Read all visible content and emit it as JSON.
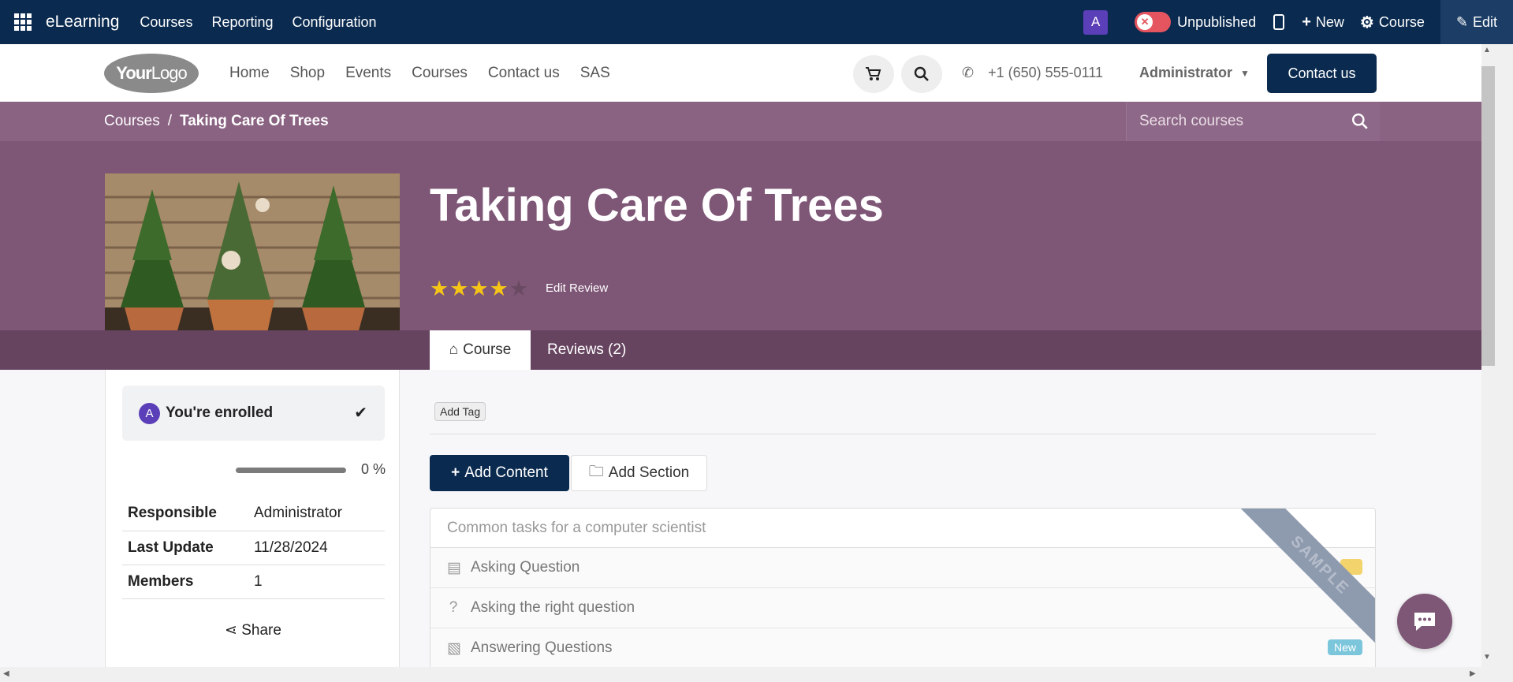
{
  "admin_bar": {
    "brand": "eLearning",
    "menu": [
      "Courses",
      "Reporting",
      "Configuration"
    ],
    "avatar_letter": "A",
    "publish_status": "Unpublished",
    "new_label": "New",
    "course_label": "Course",
    "edit_label": "Edit"
  },
  "site_header": {
    "logo_text_bold": "Your",
    "logo_text_light": "Logo",
    "nav": [
      "Home",
      "Shop",
      "Events",
      "Courses",
      "Contact us",
      "SAS"
    ],
    "phone": "+1 (650) 555-0111",
    "user": "Administrator",
    "contact_label": "Contact us"
  },
  "breadcrumb": {
    "root": "Courses",
    "separator": "/",
    "current": "Taking Care Of Trees"
  },
  "search": {
    "placeholder": "Search courses"
  },
  "course": {
    "title": "Taking Care Of Trees",
    "rating": 4,
    "max_rating": 5,
    "edit_review_label": "Edit Review"
  },
  "tabs": [
    {
      "label": "Course",
      "active": true
    },
    {
      "label": "Reviews (2)",
      "active": false
    }
  ],
  "sidebar": {
    "enrolled_avatar": "A",
    "enrolled_label": "You're enrolled",
    "progress_percent": 0,
    "progress_label": "0 %",
    "info": [
      {
        "key": "Responsible",
        "value": "Administrator"
      },
      {
        "key": "Last Update",
        "value": "11/28/2024"
      },
      {
        "key": "Members",
        "value": "1"
      }
    ],
    "share_label": "Share"
  },
  "content": {
    "add_tag_label": "Add Tag",
    "add_content_label": "Add Content",
    "add_section_label": "Add Section",
    "section_title": "Common tasks for a computer scientist",
    "lessons": [
      {
        "title": "Asking Question",
        "icon": "document-icon",
        "badge": ""
      },
      {
        "title": "Asking the right question",
        "icon": "question-icon",
        "badge": ""
      },
      {
        "title": "Answering Questions",
        "icon": "pdf-icon",
        "badge": "New"
      }
    ],
    "ribbon_label": "SAMPLE"
  },
  "colors": {
    "navy": "#0a2a4f",
    "hero": "#7e5676",
    "star": "#f5c518"
  }
}
